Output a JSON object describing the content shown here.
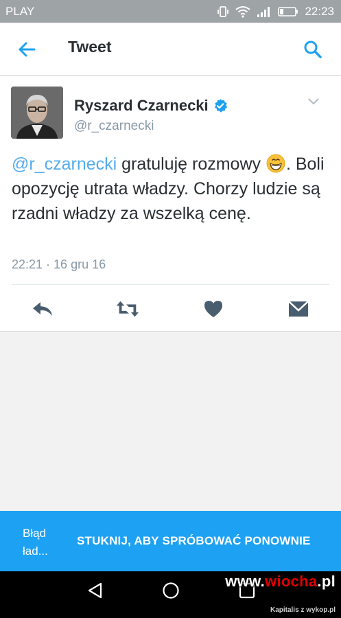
{
  "status_bar": {
    "carrier": "PLAY",
    "time": "22:23"
  },
  "app_bar": {
    "title": "Tweet"
  },
  "tweet": {
    "display_name": "Ryszard Czarnecki",
    "handle": "@r_czarnecki",
    "mention": "@r_czarnecki",
    "text_part1": " gratuluję rozmowy ",
    "text_part2": ". Boli opozycję utrata władzy. Chorzy ludzie są rzadni władzy za wszelką cenę.",
    "timestamp": "22:21 · 16 gru 16"
  },
  "actions": [
    "reply-icon",
    "retweet-icon",
    "like-icon",
    "direct-message-icon"
  ],
  "error_banner": {
    "error": "Błąd ład...",
    "retry": "STUKNIJ, ABY SPRÓBOWAĆ PONOWNIE"
  },
  "watermark": {
    "prefix": "www.",
    "name": "wiocha",
    "suffix": ".pl"
  },
  "credit": "Kapitalis z wykop.pl",
  "colors": {
    "accent": "#1da1f2",
    "link": "#55acee",
    "status_bar": "#9ea3a6"
  }
}
